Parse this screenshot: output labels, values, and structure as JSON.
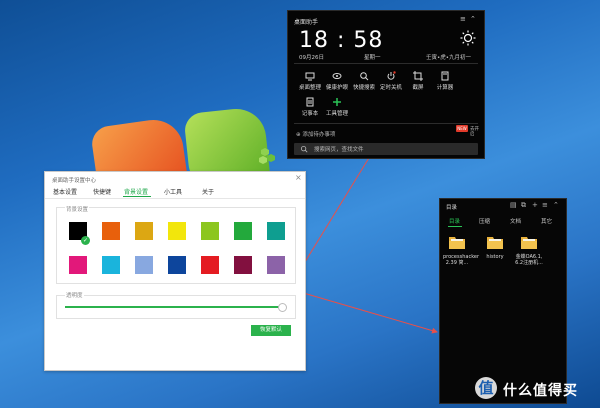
{
  "colors": {
    "accent": "#2bb24c",
    "desktop": "#1f6cc0",
    "widget_bg": "#050505"
  },
  "widget": {
    "title": "桌面助手",
    "time": "18 : 58",
    "date": "09月26日",
    "weekday": "星期一",
    "lunar": "壬寅•虎•九月初一",
    "tools": [
      "桌面整理",
      "健康护眼",
      "快捷搜索",
      "定时关机",
      "截屏",
      "计算器",
      "记事本",
      "工具管理"
    ],
    "add_todo": "添加待办事项",
    "badge": "NEW",
    "open_label": "去开启",
    "search_placeholder": "搜索网页，查找文件"
  },
  "dialog": {
    "title": "桌面助手设置中心",
    "tabs": [
      "基本设置",
      "快捷键",
      "背景设置",
      "小工具",
      "关于"
    ],
    "active_tab": "背景设置",
    "bg_section": "背景设置",
    "swatches_row1": [
      "#000000",
      "#e8600c",
      "#dca713",
      "#f2e60c",
      "#8cc61e",
      "#23a93c",
      "#0e9e90"
    ],
    "swatches_row2": [
      "#e2187a",
      "#1ab4dc",
      "#88a8e0",
      "#0d459c",
      "#e41b22",
      "#82103f",
      "#8c63a8"
    ],
    "selected_swatch": 0,
    "opacity_label": "透明度",
    "opacity_value": 1.0,
    "restore_button": "恢复默认"
  },
  "panel": {
    "title": "目录",
    "tabs": [
      "目录",
      "压缩",
      "文档",
      "其它"
    ],
    "active_tab": "目录",
    "files": [
      {
        "name": "processhacker 2.39 简...",
        "icon": "folder-icon"
      },
      {
        "name": "history",
        "icon": "folder-icon"
      },
      {
        "name": "金蝶OA6.1, 6.2注册机...",
        "icon": "folder-icon"
      }
    ]
  },
  "watermark": {
    "logo": "值",
    "text": "什么值得买"
  }
}
